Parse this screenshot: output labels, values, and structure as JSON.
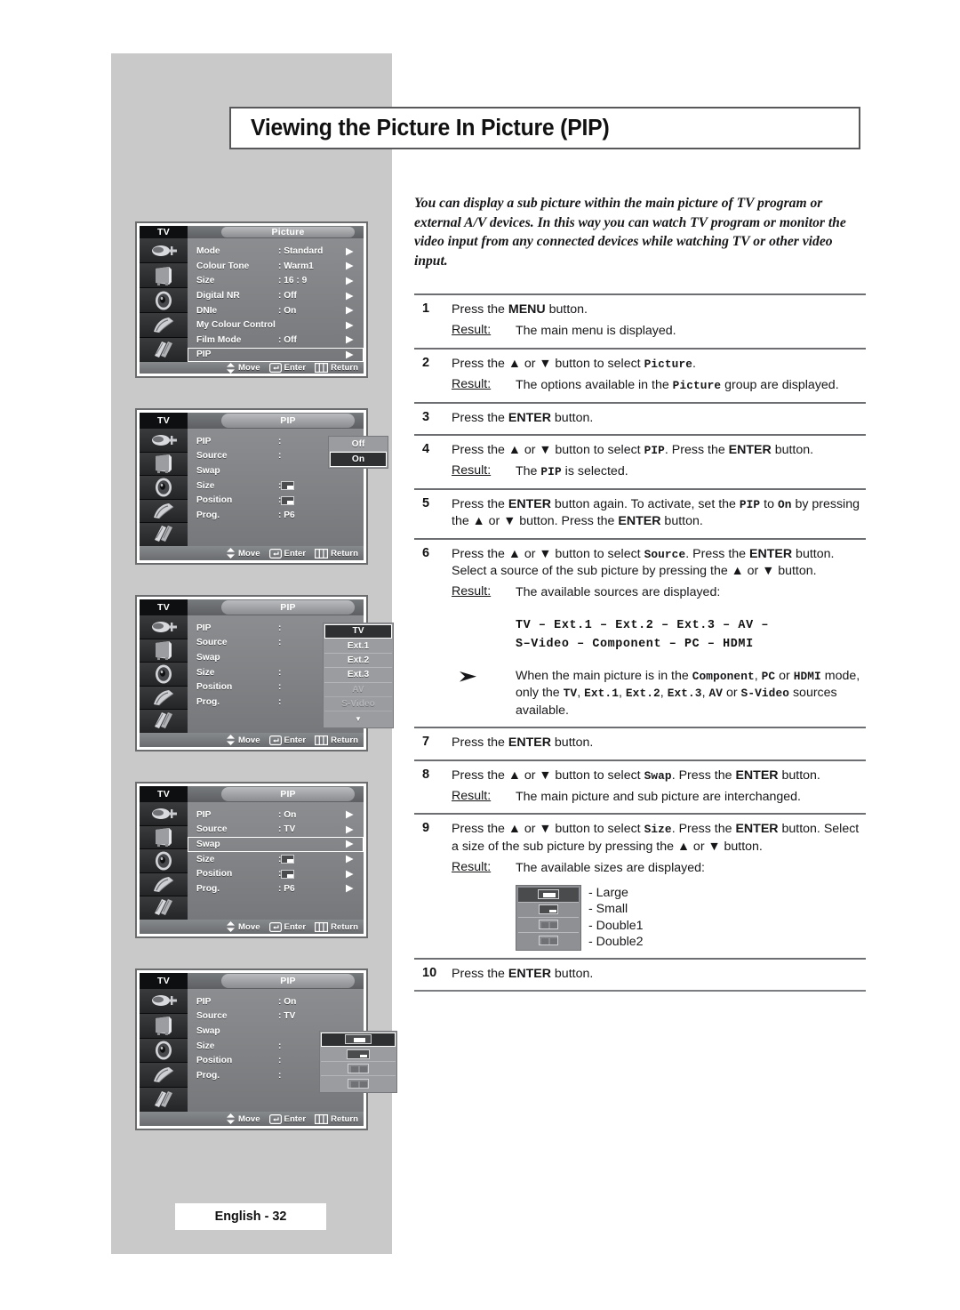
{
  "page": {
    "title": "Viewing the Picture In Picture (PIP)",
    "footer_badge": "English - 32",
    "intro": "You can display a sub picture within the main picture of TV program or external A/V devices. In this way you can watch TV program or monitor the video input from any connected devices while watching TV or other video input."
  },
  "labels": {
    "result": "Result:",
    "move": "Move",
    "enter": "Enter",
    "return": "Return",
    "tv": "TV"
  },
  "steps": [
    {
      "num": "1",
      "line_html": "Press the <b class=\"kb\">MENU</b> button.",
      "result": "The main menu is displayed."
    },
    {
      "num": "2",
      "line_html": "Press the ▲ or ▼ button to select <span class=\"mono\">Picture</span>.",
      "result_html": "The options available in the <span class=\"mono\">Picture</span> group are displayed."
    },
    {
      "num": "3",
      "line_html": "Press the <b class=\"kb\">ENTER</b> button."
    },
    {
      "num": "4",
      "line_html": "Press the ▲ or ▼ button to select <span class=\"mono\">PIP</span>. Press the <b class=\"kb\">ENTER</b> button.",
      "result_html": "The <span class=\"mono\">PIP</span> is selected."
    },
    {
      "num": "5",
      "line_html": "Press the <b class=\"kb\">ENTER</b> button again. To activate, set the <span class=\"mono\">PIP</span> to <span class=\"mono\">On</span> by pressing the ▲ or ▼ button. Press the <b class=\"kb\">ENTER</b> button."
    },
    {
      "num": "6",
      "line_html": "Press the ▲ or ▼ button to select <span class=\"mono\">Source</span>. Press the <b class=\"kb\">ENTER</b> button. Select a source of the sub picture by pressing the ▲ or ▼ button.",
      "result": "The available sources are displayed:",
      "source_list_line1": "TV – Ext.1 – Ext.2 – Ext.3 – AV –",
      "source_list_line2": "S–Video – Component – PC – HDMI",
      "note_html": "When the main picture is in the <span class=\"mono\">Component</span>, <span class=\"mono\">PC</span> or <span class=\"mono\">HDMI</span> mode, only the <span class=\"mono\">TV</span>, <span class=\"mono\">Ext.1</span>, <span class=\"mono\">Ext.2</span>, <span class=\"mono\">Ext.3</span>, <span class=\"mono\">AV</span> or <span class=\"mono\">S-Video</span> sources available."
    },
    {
      "num": "7",
      "line_html": "Press the <b class=\"kb\">ENTER</b> button."
    },
    {
      "num": "8",
      "line_html": "Press the ▲ or ▼ button to select <span class=\"mono\">Swap</span>. Press the <b class=\"kb\">ENTER</b> button.",
      "result": "The main picture and sub picture are interchanged."
    },
    {
      "num": "9",
      "line_html": "Press the ▲ or ▼ button to select <span class=\"mono\">Size</span>. Press the <b class=\"kb\">ENTER</b> button. Select a size of the sub picture by pressing the ▲ or ▼ button.",
      "result": "The available sizes are displayed:",
      "size_options": [
        "- Large",
        "- Small",
        "- Double1",
        "- Double2"
      ]
    },
    {
      "num": "10",
      "line_html": "Press the <b class=\"kb\">ENTER</b> button."
    }
  ],
  "osd_screens": [
    {
      "id": "picture-menu",
      "tab": "Picture",
      "rows": [
        {
          "label": "Mode",
          "value": ": Standard",
          "arrow": true
        },
        {
          "label": "Colour Tone",
          "value": ": Warm1",
          "arrow": true
        },
        {
          "label": "Size",
          "value": ": 16 : 9",
          "arrow": true
        },
        {
          "label": "Digital NR",
          "value": ": Off",
          "arrow": true
        },
        {
          "label": "DNIe",
          "value": ": On",
          "arrow": true
        },
        {
          "label": "My Colour Control",
          "value": "",
          "arrow": true
        },
        {
          "label": "Film Mode",
          "value": ": Off",
          "arrow": true
        },
        {
          "label": "PIP",
          "value": "",
          "arrow": true,
          "highlight": true
        }
      ]
    },
    {
      "id": "pip-onoff",
      "tab": "PIP",
      "rows": [
        {
          "label": "PIP",
          "value": ":"
        },
        {
          "label": "Source",
          "value": ":"
        },
        {
          "label": "Swap",
          "value": ""
        },
        {
          "label": "Size",
          "value": ":",
          "glyph": "large"
        },
        {
          "label": "Position",
          "value": ":",
          "glyph": "large"
        },
        {
          "label": "Prog.",
          "value": ": P6"
        }
      ],
      "popup": {
        "kind": "onoff",
        "items": [
          "Off",
          "On"
        ],
        "selected_index": 1
      }
    },
    {
      "id": "pip-source",
      "tab": "PIP",
      "rows": [
        {
          "label": "PIP",
          "value": ":"
        },
        {
          "label": "Source",
          "value": ":"
        },
        {
          "label": "Swap",
          "value": ""
        },
        {
          "label": "Size",
          "value": ":"
        },
        {
          "label": "Position",
          "value": ":"
        },
        {
          "label": "Prog.",
          "value": ":"
        }
      ],
      "popup": {
        "kind": "source",
        "items": [
          "TV",
          "Ext.1",
          "Ext.2",
          "Ext.3",
          "AV",
          "S-Video"
        ],
        "dimmed": [
          "AV",
          "S-Video"
        ],
        "selected_index": 0,
        "more": "▼"
      }
    },
    {
      "id": "pip-swap",
      "tab": "PIP",
      "rows": [
        {
          "label": "PIP",
          "value": ": On",
          "arrow": true
        },
        {
          "label": "Source",
          "value": ": TV",
          "arrow": true
        },
        {
          "label": "Swap",
          "value": "",
          "arrow": true,
          "highlight": true
        },
        {
          "label": "Size",
          "value": ":",
          "glyph": "large",
          "arrow": true
        },
        {
          "label": "Position",
          "value": ":",
          "glyph": "large",
          "arrow": true
        },
        {
          "label": "Prog.",
          "value": ": P6",
          "arrow": true
        }
      ]
    },
    {
      "id": "pip-size",
      "tab": "PIP",
      "rows": [
        {
          "label": "PIP",
          "value": ": On"
        },
        {
          "label": "Source",
          "value": ": TV"
        },
        {
          "label": "Swap",
          "value": ""
        },
        {
          "label": "Size",
          "value": ":"
        },
        {
          "label": "Position",
          "value": ":"
        },
        {
          "label": "Prog.",
          "value": ":"
        }
      ],
      "popup": {
        "kind": "size",
        "items": [
          "Large",
          "Small",
          "Double1",
          "Double2"
        ],
        "selected_index": 0
      }
    }
  ],
  "icons": {
    "side_menu": [
      "input-plug-icon",
      "picture-tv-icon",
      "sound-speaker-icon",
      "feature-icon",
      "setup-icon"
    ],
    "move": "updown-arrows-icon",
    "enter": "enter-key-icon",
    "return": "return-key-icon"
  },
  "colors": {
    "gray_column": "#c9c9c9",
    "rule": "#6d6e71",
    "osd_body": "#7f8184",
    "osd_dark": "#242527",
    "text": "#17171a"
  }
}
